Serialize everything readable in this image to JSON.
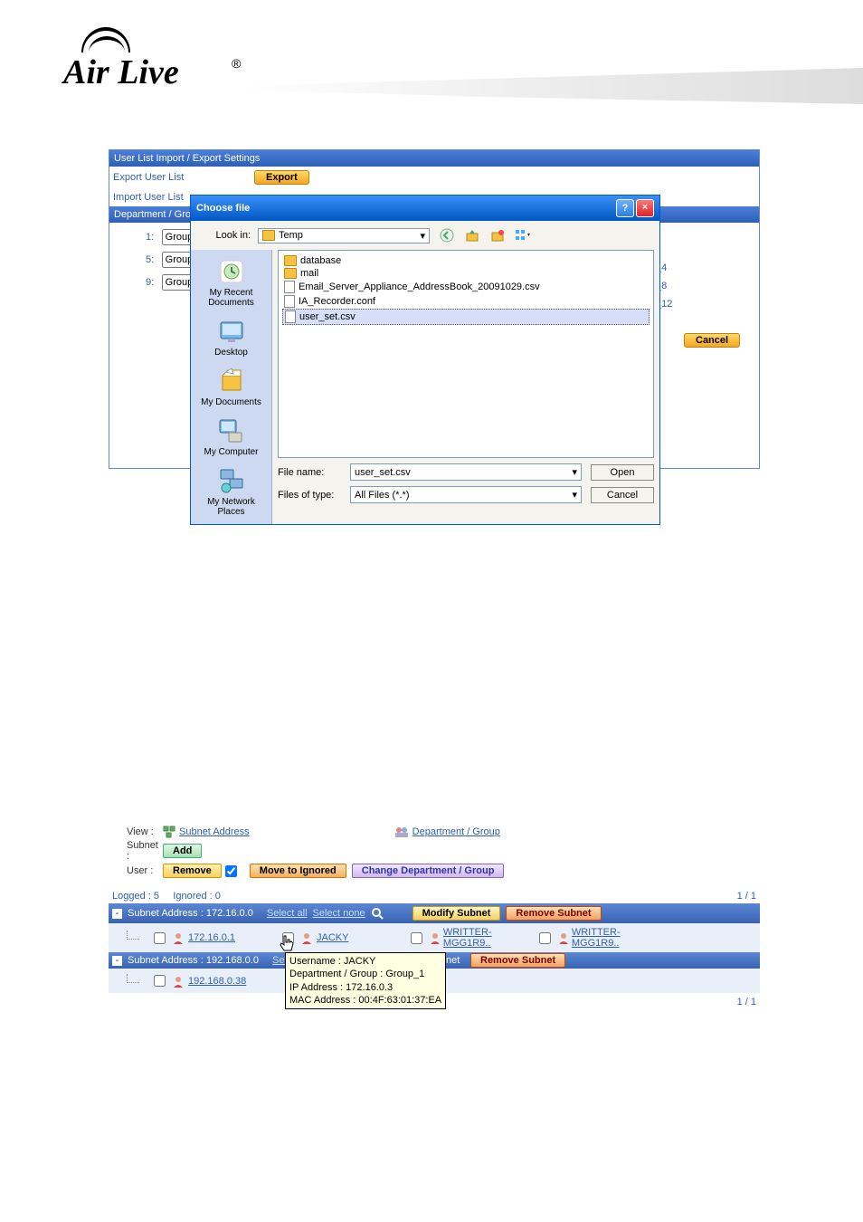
{
  "logo": {
    "text": "Air Live",
    "reg": "®"
  },
  "panel1": {
    "title": "User List Import / Export Settings",
    "export_label": "Export User List",
    "export_btn": "Export",
    "import_label": "Import User List",
    "section_label": "Department / Grou",
    "groups": [
      {
        "idx": "1:",
        "name": "Group"
      },
      {
        "idx": "5:",
        "name": "Group"
      },
      {
        "idx": "9:",
        "name": "Group"
      }
    ],
    "groups_right": [
      "_4",
      "_8",
      "_12"
    ],
    "cancel": "Cancel"
  },
  "file_dialog": {
    "title": "Choose file",
    "help": "?",
    "close": "×",
    "look_in_label": "Look in:",
    "look_in_value": "Temp",
    "places": [
      {
        "name": "My Recent Documents"
      },
      {
        "name": "Desktop"
      },
      {
        "name": "My Documents"
      },
      {
        "name": "My Computer"
      },
      {
        "name": "My Network Places"
      }
    ],
    "items": [
      {
        "type": "folder",
        "name": "database"
      },
      {
        "type": "folder",
        "name": "mail"
      },
      {
        "type": "file",
        "name": "Email_Server_Appliance_AddressBook_20091029.csv"
      },
      {
        "type": "file",
        "name": "IA_Recorder.conf"
      },
      {
        "type": "file",
        "name": "user_set.csv",
        "selected": true
      }
    ],
    "file_name_label": "File name:",
    "file_name_value": "user_set.csv",
    "file_type_label": "Files of type:",
    "file_type_value": "All Files (*.*)",
    "open": "Open",
    "cancel": "Cancel"
  },
  "listpanel": {
    "view_label": "View :",
    "subnet_address_link": "Subnet Address",
    "dept_group_link": "Department / Group",
    "subnet_label": "Subnet :",
    "add_btn": "Add",
    "user_label": "User :",
    "remove_btn": "Remove",
    "move_btn": "Move to Ignored",
    "change_btn": "Change Department / Group",
    "logged": "Logged : 5",
    "ignored": "Ignored : 0",
    "paging": "1 / 1",
    "subnet1": {
      "title": "Subnet Address : 172.16.0.0",
      "select_all": "Select all",
      "select_none": "Select none",
      "modify": "Modify Subnet",
      "remove": "Remove Subnet",
      "users": [
        {
          "ip": "172.16.0.1",
          "name": "JACKY",
          "n2": "WRITTER-MGG1R9..",
          "n3": "WRITTER-MGG1R9.."
        }
      ]
    },
    "subnet2": {
      "title": "Subnet Address : 192.168.0.0",
      "select_prefix": "Select",
      "net_stub": "net",
      "remove": "Remove Subnet",
      "users": [
        {
          "ip": "192.168.0.38"
        }
      ]
    },
    "tooltip": {
      "l1": "Username : JACKY",
      "l2": "Department / Group : Group_1",
      "l3": "IP Address : 172.16.0.3",
      "l4": "MAC Address : 00:4F:63:01:37:EA"
    }
  }
}
